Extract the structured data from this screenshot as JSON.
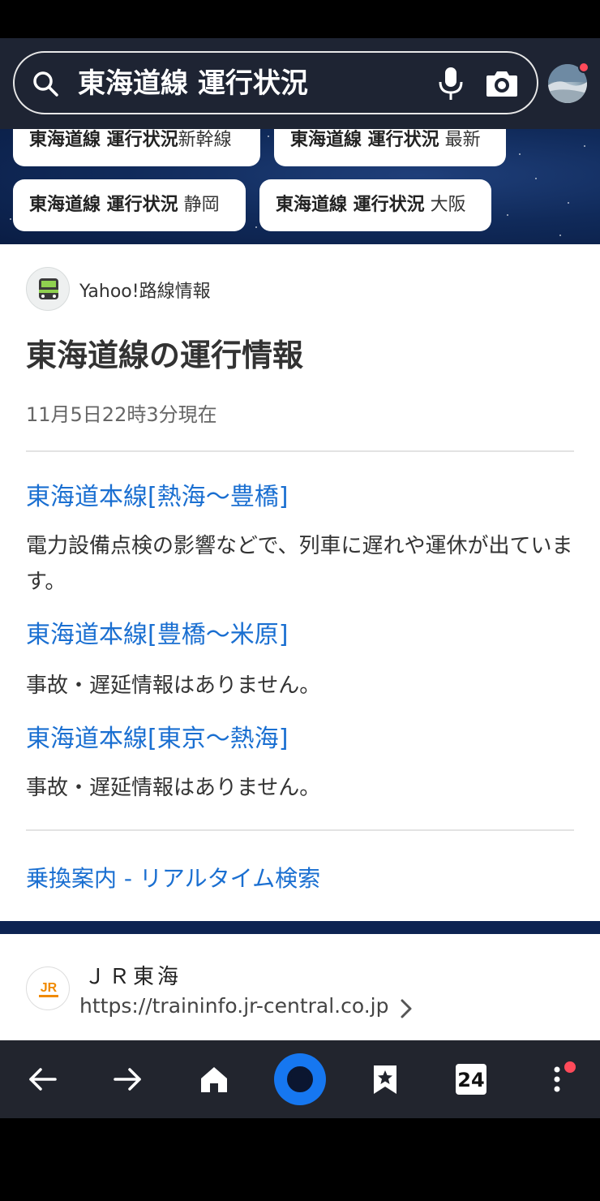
{
  "search": {
    "query": "東海道線 運行状況",
    "icons": [
      "search-icon",
      "microphone-icon",
      "camera-icon"
    ]
  },
  "suggestions": [
    {
      "bold": "東海道線 運行状況",
      "rest": "新幹線"
    },
    {
      "bold": "東海道線 運行状況",
      "rest": " 最新"
    },
    {
      "bold": "東海道線 運行状況",
      "rest": " 静岡"
    },
    {
      "bold": "東海道線 運行状況",
      "rest": " 大阪"
    }
  ],
  "card": {
    "source": "Yahoo!路線情報",
    "title": "東海道線の運行情報",
    "timestamp": "11月5日22時3分現在",
    "routes": [
      {
        "name": "東海道本線[熱海～豊橋]",
        "status": "電力設備点検の影響などで、列車に遅れや運休が出ています。"
      },
      {
        "name": "東海道本線[豊橋～米原]",
        "status": "事故・遅延情報はありません。"
      },
      {
        "name": "東海道本線[東京～熱海]",
        "status": "事故・遅延情報はありません。"
      }
    ],
    "transfer_link": "乗換案内 - リアルタイム検索"
  },
  "result2": {
    "title": "ＪＲ東海",
    "url": "https://traininfo.jr-central.co.jp"
  },
  "bottom_nav": {
    "tab_count": "24",
    "items": [
      "back-arrow-icon",
      "forward-arrow-icon",
      "home-icon",
      "search-circle-button",
      "bookmark-star-icon",
      "tab-counter",
      "more-menu-icon"
    ]
  },
  "colors": {
    "header_bg": "#1e2433",
    "link": "#1a6fd1",
    "accent": "#1677f0",
    "notification": "#ff4a5a"
  }
}
